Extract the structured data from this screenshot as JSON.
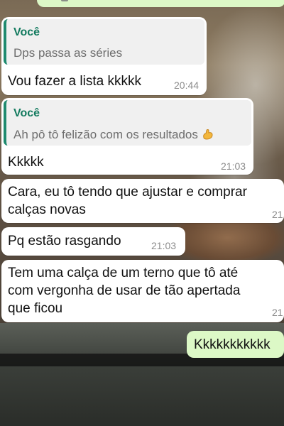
{
  "messages": [
    {
      "quote": {
        "author": "Você",
        "text": "Dps passa as séries"
      },
      "text": "Vou fazer a lista kkkkk",
      "time": "20:44"
    },
    {
      "quote": {
        "author": "Você",
        "text": "Ah pô tô felizão com os resultados",
        "emoji": "flexed-biceps-icon"
      },
      "text": "Kkkkk",
      "time": "21:03"
    },
    {
      "text_lines": [
        "Cara, eu tô tendo que ajustar e comprar",
        "calças novas"
      ],
      "time": "21"
    },
    {
      "text": "Pq estão rasgando",
      "time": "21:03"
    },
    {
      "text_lines": [
        "Tem uma calça de um terno que tô até",
        "com vergonha de usar de tão apertada",
        "que ficou"
      ],
      "time": "21"
    },
    {
      "text": "Kkkkkkkkkkk",
      "outgoing": true
    }
  ],
  "colors": {
    "incoming_bubble": "#ffffff",
    "outgoing_bubble": "#dcf8c6",
    "quote_bar": "#1e8a6e",
    "quote_author": "#127a5e"
  }
}
